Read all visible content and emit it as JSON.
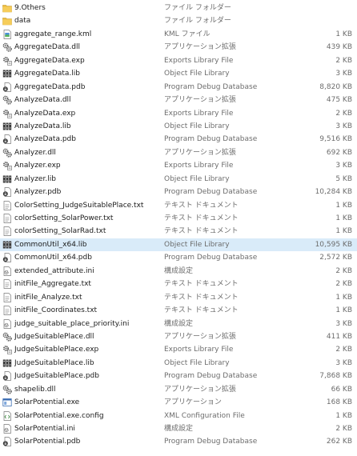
{
  "files": [
    {
      "name": "9.Others",
      "type": "ファイル フォルダー",
      "size": "",
      "icon": "folder-icon"
    },
    {
      "name": "data",
      "type": "ファイル フォルダー",
      "size": "",
      "icon": "folder-icon"
    },
    {
      "name": "aggregate_range.kml",
      "type": "KML ファイル",
      "size": "1 KB",
      "icon": "kml-file-icon"
    },
    {
      "name": "AggregateData.dll",
      "type": "アプリケーション拡張",
      "size": "439 KB",
      "icon": "dll-file-icon"
    },
    {
      "name": "AggregateData.exp",
      "type": "Exports Library File",
      "size": "2 KB",
      "icon": "exp-file-icon"
    },
    {
      "name": "AggregateData.lib",
      "type": "Object File Library",
      "size": "3 KB",
      "icon": "lib-file-icon"
    },
    {
      "name": "AggregateData.pdb",
      "type": "Program Debug Database",
      "size": "8,820 KB",
      "icon": "pdb-file-icon"
    },
    {
      "name": "AnalyzeData.dll",
      "type": "アプリケーション拡張",
      "size": "475 KB",
      "icon": "dll-file-icon"
    },
    {
      "name": "AnalyzeData.exp",
      "type": "Exports Library File",
      "size": "2 KB",
      "icon": "exp-file-icon"
    },
    {
      "name": "AnalyzeData.lib",
      "type": "Object File Library",
      "size": "3 KB",
      "icon": "lib-file-icon"
    },
    {
      "name": "AnalyzeData.pdb",
      "type": "Program Debug Database",
      "size": "9,516 KB",
      "icon": "pdb-file-icon"
    },
    {
      "name": "Analyzer.dll",
      "type": "アプリケーション拡張",
      "size": "692 KB",
      "icon": "dll-file-icon"
    },
    {
      "name": "Analyzer.exp",
      "type": "Exports Library File",
      "size": "3 KB",
      "icon": "exp-file-icon"
    },
    {
      "name": "Analyzer.lib",
      "type": "Object File Library",
      "size": "5 KB",
      "icon": "lib-file-icon"
    },
    {
      "name": "Analyzer.pdb",
      "type": "Program Debug Database",
      "size": "10,284 KB",
      "icon": "pdb-file-icon"
    },
    {
      "name": "ColorSetting_JudgeSuitablePlace.txt",
      "type": "テキスト ドキュメント",
      "size": "1 KB",
      "icon": "text-file-icon"
    },
    {
      "name": "colorSetting_SolarPower.txt",
      "type": "テキスト ドキュメント",
      "size": "1 KB",
      "icon": "text-file-icon"
    },
    {
      "name": "colorSetting_SolarRad.txt",
      "type": "テキスト ドキュメント",
      "size": "1 KB",
      "icon": "text-file-icon"
    },
    {
      "name": "CommonUtil_x64.lib",
      "type": "Object File Library",
      "size": "10,595 KB",
      "icon": "lib-file-icon",
      "selected": true
    },
    {
      "name": "CommonUtil_x64.pdb",
      "type": "Program Debug Database",
      "size": "2,572 KB",
      "icon": "pdb-file-icon"
    },
    {
      "name": "extended_attribute.ini",
      "type": "構成設定",
      "size": "2 KB",
      "icon": "ini-file-icon"
    },
    {
      "name": "initFile_Aggregate.txt",
      "type": "テキスト ドキュメント",
      "size": "2 KB",
      "icon": "text-file-icon"
    },
    {
      "name": "initFile_Analyze.txt",
      "type": "テキスト ドキュメント",
      "size": "1 KB",
      "icon": "text-file-icon"
    },
    {
      "name": "initFile_Coordinates.txt",
      "type": "テキスト ドキュメント",
      "size": "1 KB",
      "icon": "text-file-icon"
    },
    {
      "name": "judge_suitable_place_priority.ini",
      "type": "構成設定",
      "size": "3 KB",
      "icon": "ini-file-icon"
    },
    {
      "name": "JudgeSuitablePlace.dll",
      "type": "アプリケーション拡張",
      "size": "411 KB",
      "icon": "dll-file-icon"
    },
    {
      "name": "JudgeSuitablePlace.exp",
      "type": "Exports Library File",
      "size": "2 KB",
      "icon": "exp-file-icon"
    },
    {
      "name": "JudgeSuitablePlace.lib",
      "type": "Object File Library",
      "size": "3 KB",
      "icon": "lib-file-icon"
    },
    {
      "name": "JudgeSuitablePlace.pdb",
      "type": "Program Debug Database",
      "size": "7,868 KB",
      "icon": "pdb-file-icon"
    },
    {
      "name": "shapelib.dll",
      "type": "アプリケーション拡張",
      "size": "66 KB",
      "icon": "dll-file-icon"
    },
    {
      "name": "SolarPotential.exe",
      "type": "アプリケーション",
      "size": "168 KB",
      "icon": "exe-file-icon"
    },
    {
      "name": "SolarPotential.exe.config",
      "type": "XML Configuration File",
      "size": "1 KB",
      "icon": "config-file-icon"
    },
    {
      "name": "SolarPotential.ini",
      "type": "構成設定",
      "size": "2 KB",
      "icon": "ini-file-icon"
    },
    {
      "name": "SolarPotential.pdb",
      "type": "Program Debug Database",
      "size": "262 KB",
      "icon": "pdb-file-icon"
    }
  ],
  "colors": {
    "selection": "#d9ebf9",
    "folder": "#e8b93c",
    "secondary_text": "#6d6d6d"
  }
}
